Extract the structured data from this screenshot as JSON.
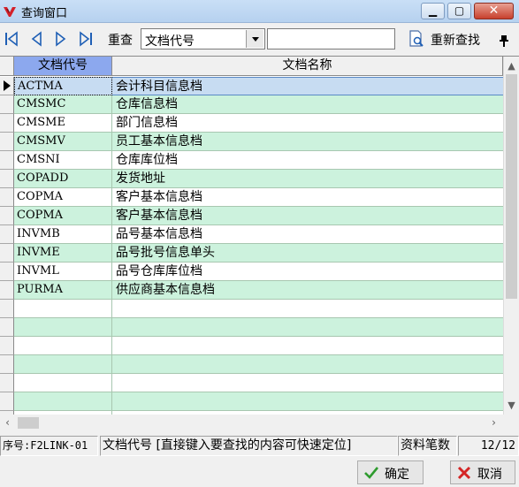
{
  "window": {
    "title": "查询窗口",
    "icon": "brand-logo-icon"
  },
  "toolbar": {
    "first_icon": "first-record-icon",
    "prev_icon": "previous-record-icon",
    "next_icon": "next-record-icon",
    "last_icon": "last-record-icon",
    "reset_label": "重查",
    "field_select_value": "文档代号",
    "search_value": "",
    "refind_label": "重新查找"
  },
  "table": {
    "columns": [
      "文档代号",
      "文档名称"
    ],
    "rows": [
      {
        "code": "ACTMA",
        "name": "会计科目信息档"
      },
      {
        "code": "CMSMC",
        "name": "仓库信息档"
      },
      {
        "code": "CMSME",
        "name": "部门信息档"
      },
      {
        "code": "CMSMV",
        "name": "员工基本信息档"
      },
      {
        "code": "CMSNI",
        "name": "仓库库位档"
      },
      {
        "code": "COPADD",
        "name": "发货地址"
      },
      {
        "code": "COPMA",
        "name": "客户基本信息档"
      },
      {
        "code": "COPMA",
        "name": "客户基本信息档"
      },
      {
        "code": "INVMB",
        "name": "品号基本信息档"
      },
      {
        "code": "INVME",
        "name": "品号批号信息单头"
      },
      {
        "code": "INVML",
        "name": "品号仓库库位档"
      },
      {
        "code": "PURMA",
        "name": "供应商基本信息档"
      }
    ],
    "selected_index": 0,
    "empty_rows": 7
  },
  "status": {
    "seq": "序号:F2LINK-01",
    "hint": "文档代号 [直接键入要查找的内容可快速定位]",
    "count_label": "资料笔数",
    "count_value": "12/12"
  },
  "buttons": {
    "ok_label": "确定",
    "cancel_label": "取消"
  },
  "colors": {
    "header_active": "#8ca8ee",
    "row_alt": "#ccf2dd",
    "row_selected": "#c7dcf2"
  }
}
